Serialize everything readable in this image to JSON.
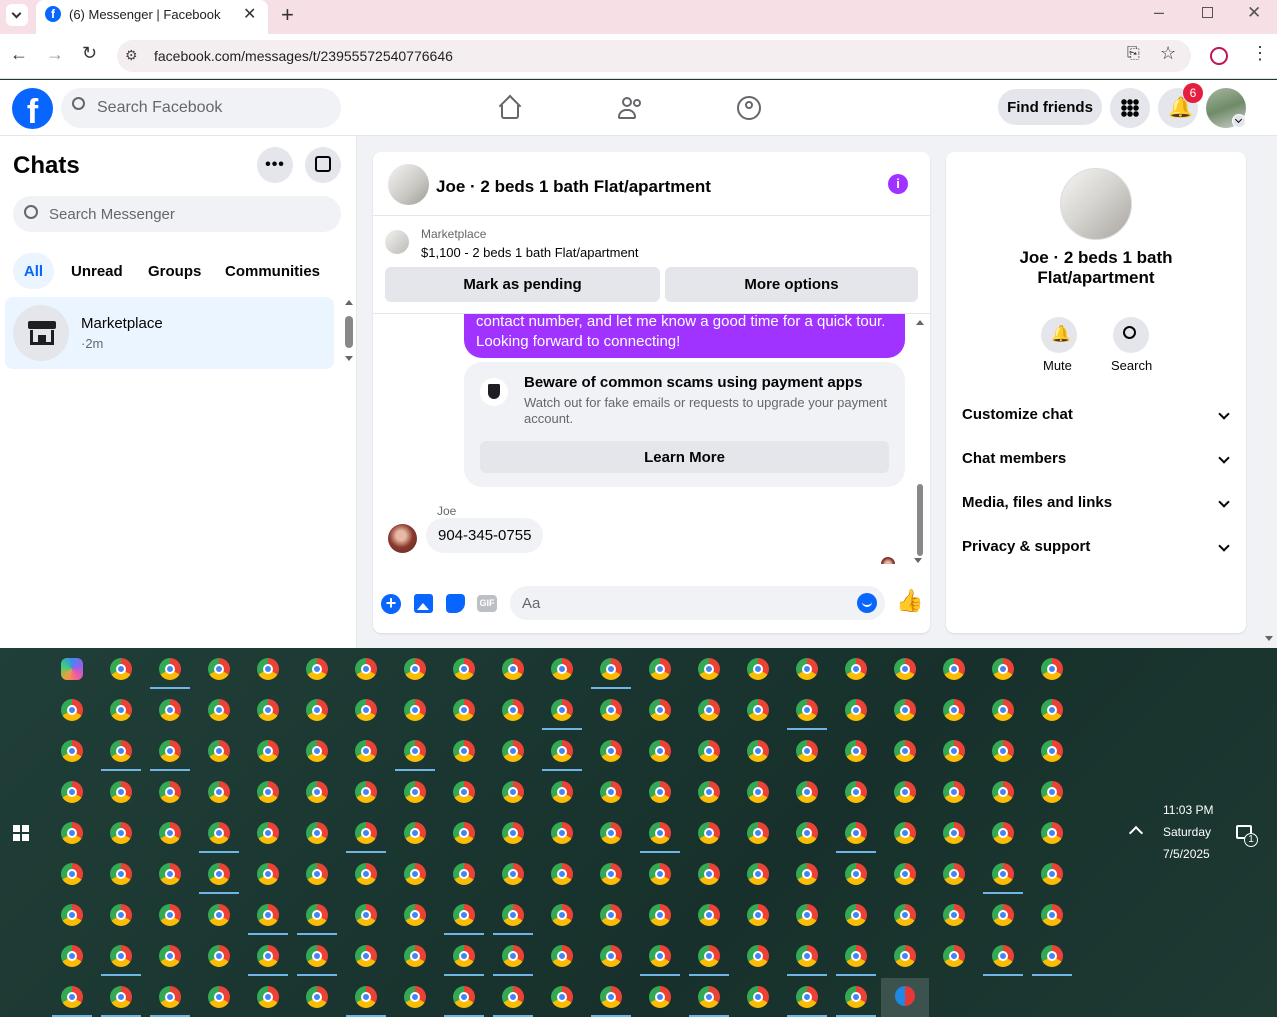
{
  "browser": {
    "tab_title": "(6) Messenger | Facebook",
    "url": "facebook.com/messages/t/23955572540776646"
  },
  "header": {
    "search_placeholder": "Search Facebook",
    "find_friends": "Find friends",
    "notification_count": "6"
  },
  "sidebar": {
    "title": "Chats",
    "search_placeholder": "Search Messenger",
    "filters": [
      "All",
      "Unread",
      "Groups",
      "Communities"
    ],
    "chat_item": {
      "name": "Marketplace",
      "time": "·2m"
    }
  },
  "conversation": {
    "title": "Joe · 2 beds 1 bath Flat/apartment",
    "listing_source": "Marketplace",
    "listing_detail": "$1,100 - 2 beds 1 bath Flat/apartment",
    "mark_pending": "Mark as pending",
    "more_options": "More options",
    "sent_message": "contact number, and let me know a good time for a quick tour. Looking forward to connecting!",
    "scam_title": "Beware of common scams using payment apps",
    "scam_body": "Watch out for fake emails or requests to upgrade your payment account.",
    "learn_more": "Learn More",
    "sender": "Joe",
    "received_message": "904-345-0755",
    "composer_placeholder": "Aa"
  },
  "details": {
    "title": "Joe · 2 beds 1 bath Flat/apartment",
    "mute": "Mute",
    "search": "Search",
    "sections": [
      "Customize chat",
      "Chat members",
      "Media, files and links",
      "Privacy & support"
    ]
  },
  "taskbar": {
    "time": "11:03 PM",
    "day": "Saturday",
    "date": "7/5/2025",
    "notification_count": "1"
  },
  "colors": {
    "accent": "#0866ff",
    "messenger_purple": "#a033ff",
    "notification_red": "#e41e3f"
  }
}
